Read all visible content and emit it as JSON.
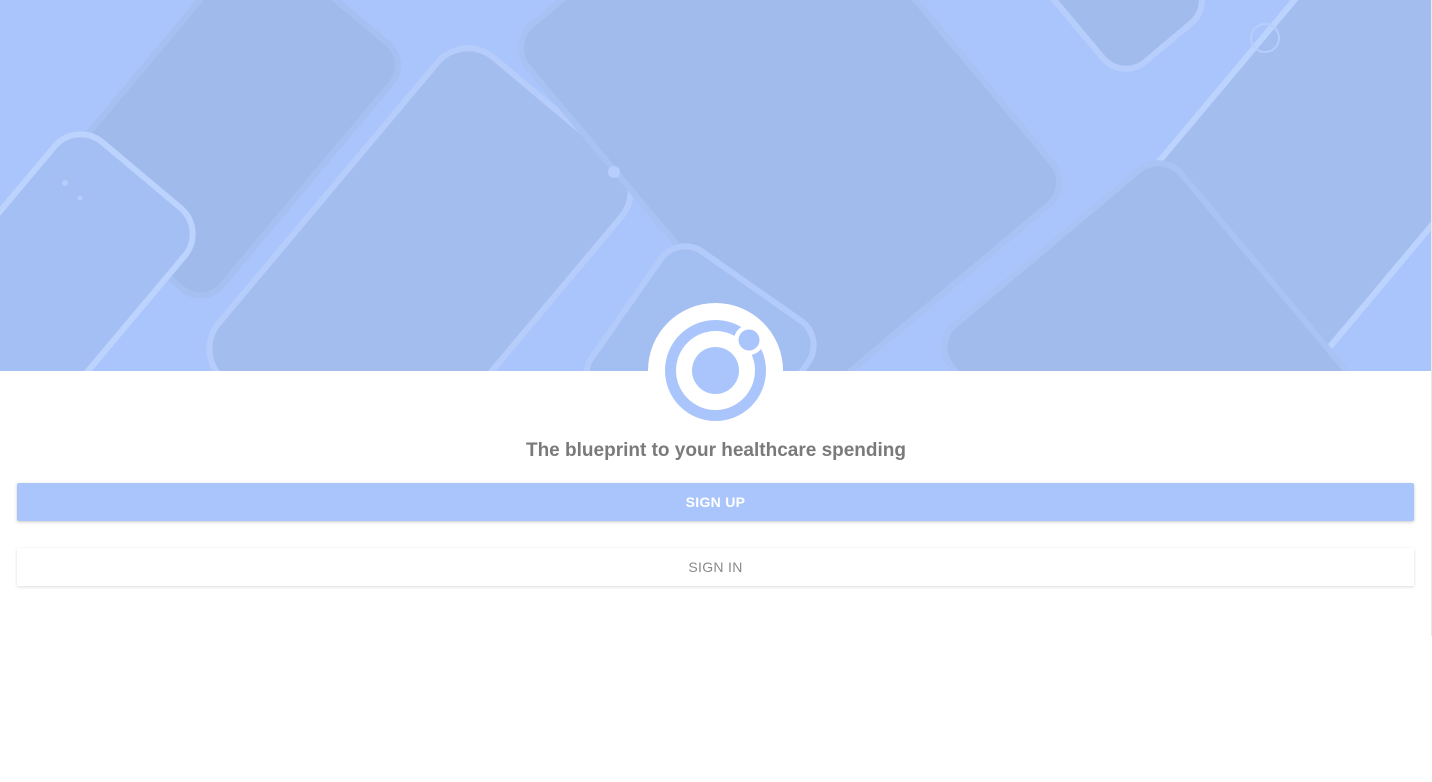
{
  "hero": {
    "background_color": "#a9c5fb",
    "decoration": "device-pattern"
  },
  "logo": {
    "icon": "ionic-logo-icon",
    "color": "#a9c5fb"
  },
  "tagline": "The blueprint to your healthcare spending",
  "actions": {
    "signup_label": "SIGN UP",
    "signin_label": "SIGN IN"
  },
  "colors": {
    "primary": "#a9c5fb",
    "text_muted": "#7a7a7a",
    "background": "#ffffff"
  }
}
